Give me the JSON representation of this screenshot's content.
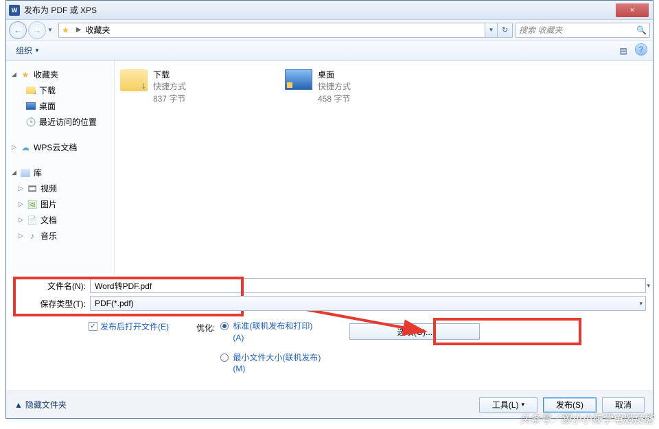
{
  "window": {
    "title": "发布为 PDF 或 XPS",
    "close": "×",
    "min": "—",
    "max": "☐"
  },
  "nav": {
    "back": "←",
    "forward": "→",
    "location": "收藏夹",
    "refresh": "↻"
  },
  "search": {
    "placeholder": "搜索 收藏夹"
  },
  "toolbar": {
    "organize": "组织",
    "view_icon": "▤",
    "help_icon": "?"
  },
  "sidebar": {
    "favorites": "收藏夹",
    "downloads": "下载",
    "desktop": "桌面",
    "recent": "最近访问的位置",
    "wps": "WPS云文档",
    "libraries": "库",
    "videos": "视频",
    "pictures": "图片",
    "documents": "文档",
    "music": "音乐"
  },
  "content": {
    "items": [
      {
        "name": "下载",
        "type": "快捷方式",
        "size": "837 字节"
      },
      {
        "name": "桌面",
        "type": "快捷方式",
        "size": "458 字节"
      }
    ]
  },
  "form": {
    "filename_label": "文件名(N):",
    "filename_value": "Word转PDF.pdf",
    "savetype_label": "保存类型(T):",
    "savetype_value": "PDF(*.pdf)",
    "open_after": "发布后打开文件(E)",
    "optimize_label": "优化:",
    "opt_standard": "标准(联机发布和打印)(A)",
    "opt_min": "最小文件大小(联机发布)(M)",
    "options_btn": "选项(O)..."
  },
  "footer": {
    "hide_folders": "隐藏文件夹",
    "tools": "工具(L)",
    "publish": "发布(S)",
    "cancel": "取消"
  },
  "watermark": "头条号／跟小小筱学电脑技能"
}
